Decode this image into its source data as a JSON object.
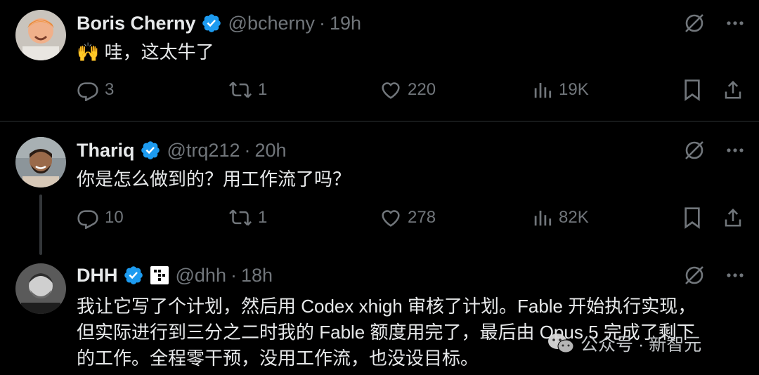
{
  "tweets": [
    {
      "name": "Boris Cherny",
      "handle": "@bcherny",
      "separator": "·",
      "time": "19h",
      "text_lines": [
        "🙌 哇，这太牛了"
      ],
      "actions": {
        "replies": "3",
        "retweets": "1",
        "likes": "220",
        "views": "19K"
      }
    },
    {
      "name": "Thariq",
      "handle": "@trq212",
      "separator": "·",
      "time": "20h",
      "text_lines": [
        "你是怎么做到的？用工作流了吗？"
      ],
      "actions": {
        "replies": "10",
        "retweets": "1",
        "likes": "278",
        "views": "82K"
      }
    },
    {
      "name": "DHH",
      "handle": "@dhh",
      "separator": "·",
      "time": "18h",
      "text_lines": [
        "我让它写了个计划，然后用 Codex xhigh 审核了计划。Fable 开始执行实现，",
        "但实际进行到三分之二时我的 Fable 额度用完了，最后由 Opus 5 完成了剩下",
        "的工作。全程零干预，没用工作流，也没设目标。"
      ]
    }
  ],
  "watermark": {
    "text": "公众号 · 新智元"
  },
  "colors": {
    "background": "#000000",
    "text": "#e7e9ea",
    "muted": "#71767b",
    "verified": "#1d9bf0"
  },
  "icons": [
    "reply-icon",
    "retweet-icon",
    "like-icon",
    "views-icon",
    "bookmark-icon",
    "share-icon",
    "grok-icon",
    "more-icon",
    "verified-badge-icon"
  ]
}
